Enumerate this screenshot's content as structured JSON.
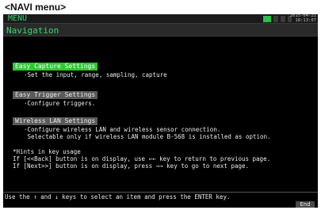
{
  "caption": "<NAVI menu>",
  "header": {
    "title": "MENU",
    "date": "2015-04-21",
    "time": "18:13:07",
    "status_icons": [
      "card-icon",
      "wireless-icon",
      "signal-icon",
      "battery-icon"
    ]
  },
  "nav_title": "Navigation",
  "items": [
    {
      "label": "Easy Capture Settings",
      "selected": true,
      "description": "·Set the input, range, sampling, capture"
    },
    {
      "label": "Easy Trigger Settings",
      "selected": false,
      "description": "·Configure triggers."
    },
    {
      "label": "Wireless LAN Settings",
      "selected": false,
      "description": "·Configure wireless LAN and wireless sensor connection.\n Selectable only if wireless LAN module B-568 is installed as option."
    }
  ],
  "hints": {
    "title": "*Hints in key usage",
    "line1": "If [<<Back] button is on display, use ←← key to return to previous page.",
    "line2": "If [Next>>] button is on display, press →→ key to go to next page."
  },
  "status_line": "Use the ↑ and ↓ keys to select an item and press the ENTER key.",
  "end_button": "End",
  "colors": {
    "accent": "#2fc92f",
    "title_green": "#36d66b",
    "background": "#000000"
  }
}
